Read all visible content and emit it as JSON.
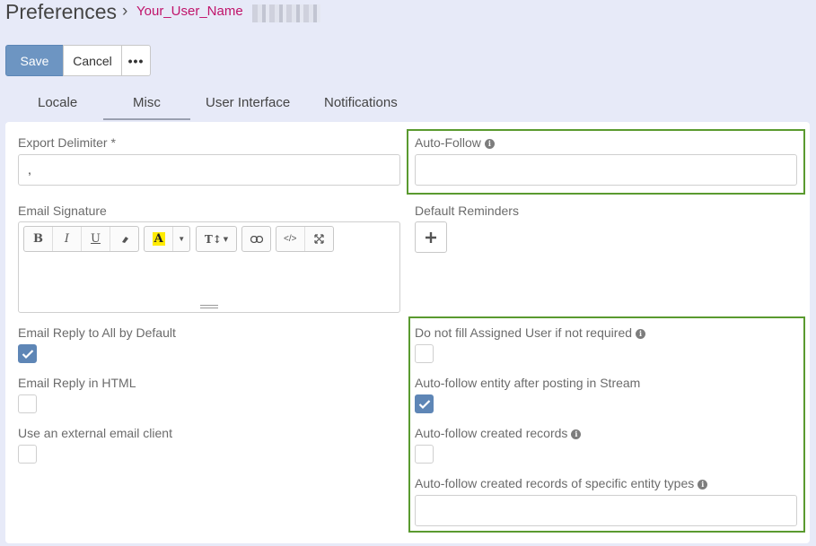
{
  "header": {
    "title": "Preferences",
    "separator": "›",
    "user_name": "Your_User_Name"
  },
  "toolbar": {
    "save_label": "Save",
    "cancel_label": "Cancel",
    "more_label": "•••"
  },
  "tabs": [
    {
      "label": "Locale"
    },
    {
      "label": "Misc",
      "active": true
    },
    {
      "label": "User Interface"
    },
    {
      "label": "Notifications"
    }
  ],
  "fields": {
    "export_delimiter": {
      "label": "Export Delimiter *",
      "value": ","
    },
    "auto_follow": {
      "label": "Auto-Follow",
      "value": ""
    },
    "email_signature": {
      "label": "Email Signature"
    },
    "default_reminders": {
      "label": "Default Reminders"
    },
    "email_reply_all": {
      "label": "Email Reply to All by Default",
      "checked": true
    },
    "email_reply_html": {
      "label": "Email Reply in HTML",
      "checked": false
    },
    "external_email": {
      "label": "Use an external email client",
      "checked": false
    },
    "no_fill_assigned": {
      "label": "Do not fill Assigned User if not required",
      "checked": false
    },
    "follow_after_posting": {
      "label": "Auto-follow entity after posting in Stream",
      "checked": true
    },
    "follow_created": {
      "label": "Auto-follow created records",
      "checked": false
    },
    "follow_created_types": {
      "label": "Auto-follow created records of specific entity types",
      "value": ""
    }
  },
  "editor_toolbar": [
    "B",
    "I",
    "U",
    "A",
    "T↕",
    "</>"
  ],
  "colors": {
    "background": "#e7eaf8",
    "accent": "#6d95c2",
    "highlight": "#5a9a2f",
    "user_link": "#c0136a"
  }
}
